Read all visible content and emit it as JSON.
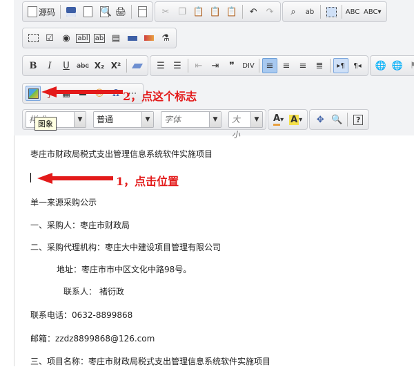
{
  "toolbar": {
    "source_label": "源码",
    "font_size_symbols": {
      "subscript": "X₂",
      "superscript": "X²"
    },
    "format_combo": "普通",
    "font_combo": "字体",
    "size_combo": "大小",
    "style_combo": "样式"
  },
  "tooltip": "图象",
  "annotations": {
    "step2": "2，点这个标志",
    "step1": "1，点击位置"
  },
  "editor": {
    "lines": [
      "枣庄市财政局税式支出管理信息系统软件实施项目",
      "单一来源采购公示",
      "一、采购人：枣庄市财政局",
      "二、采购代理机构：枣庄大中建设项目管理有限公司",
      "地址：枣庄市市中区文化中路98号。",
      "联系人： 褚衍政",
      "联系电话：0632-8899868",
      "邮箱：zzdz8899868@126.com",
      "三、项目名称：枣庄市财政局税式支出管理信息系统软件实施项目"
    ]
  },
  "colors": {
    "annotation": "#e31a1a",
    "toolbar_bg": "#f2f3f5",
    "active_button": "#a8c9f0"
  }
}
